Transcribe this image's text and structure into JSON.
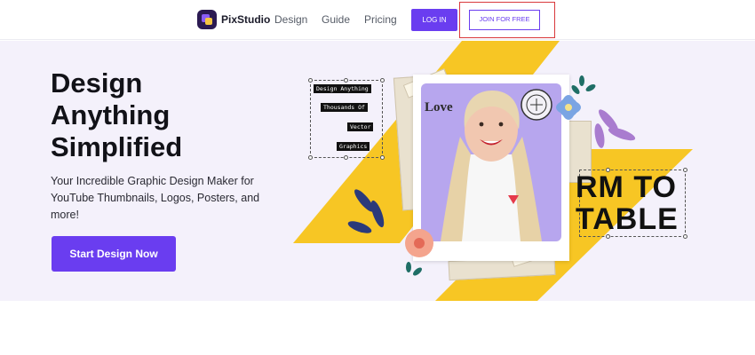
{
  "header": {
    "brand": "PixStudio",
    "nav": [
      "Design",
      "Guide",
      "Pricing"
    ],
    "login_label": "LOG IN",
    "join_label": "JOIN FOR FREE"
  },
  "hero": {
    "title_lines": [
      "Design",
      "Anything",
      "Simplified"
    ],
    "subtitle_lines": [
      "Your Incredible Graphic Design Maker for",
      "YouTube Thumbnails, Logos, Posters, and",
      "more!"
    ],
    "cta_label": "Start Design Now"
  },
  "collage": {
    "tags": [
      "Design Anything",
      "Thousands Of",
      "Vector",
      "Graphics"
    ],
    "love_text": "Love",
    "bold_lines": [
      "RM TO",
      "TABLE"
    ]
  },
  "colors": {
    "accent": "#6a3df0",
    "hero_bg": "#f4f1fb",
    "yellow": "#f7c624",
    "highlight": "#d9393c"
  }
}
